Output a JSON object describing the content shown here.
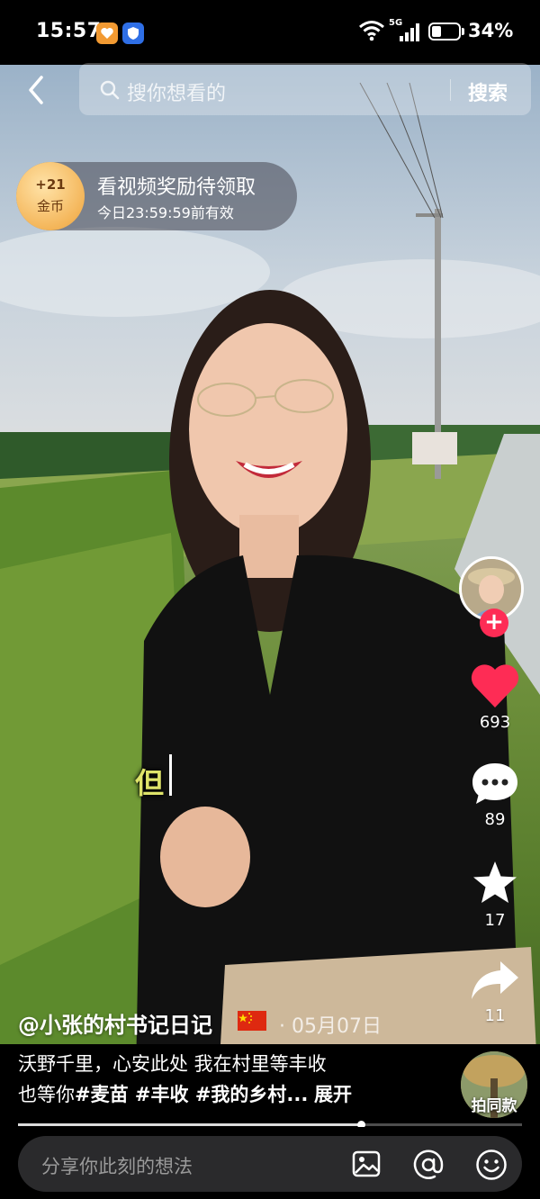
{
  "status_bar": {
    "time": "15:57",
    "network_label": "5G",
    "battery_percent": "34%",
    "battery_level": 0.34
  },
  "search": {
    "placeholder": "搜你想看的",
    "button_label": "搜索"
  },
  "reward": {
    "coin_amount": "+21",
    "coin_unit": "金币",
    "title": "看视频奖励待领取",
    "subtitle": "今日23:59:59前有效"
  },
  "video": {
    "caption_char": "但",
    "progress": 0.68
  },
  "actions": {
    "like_count": "693",
    "comment_count": "89",
    "favorite_count": "17",
    "share_count": "11",
    "like_color": "#fe2c55"
  },
  "post": {
    "author": "@小张的村书记日记",
    "date": "· 05月07日",
    "desc_line1": "沃野千里，心安此处 我在村里等丰收",
    "desc_line2_prefix": "也等你",
    "desc_hashtags": "#麦苗 #丰收 #我的乡村...",
    "expand_label": "展开",
    "same_style_label": "拍同款"
  },
  "comment_bar": {
    "placeholder": "分享你此刻的想法"
  },
  "icons": [
    "back-icon",
    "search-icon",
    "image-icon",
    "at-icon",
    "emoji-icon",
    "heart-icon",
    "comment-icon",
    "star-icon",
    "share-icon"
  ]
}
